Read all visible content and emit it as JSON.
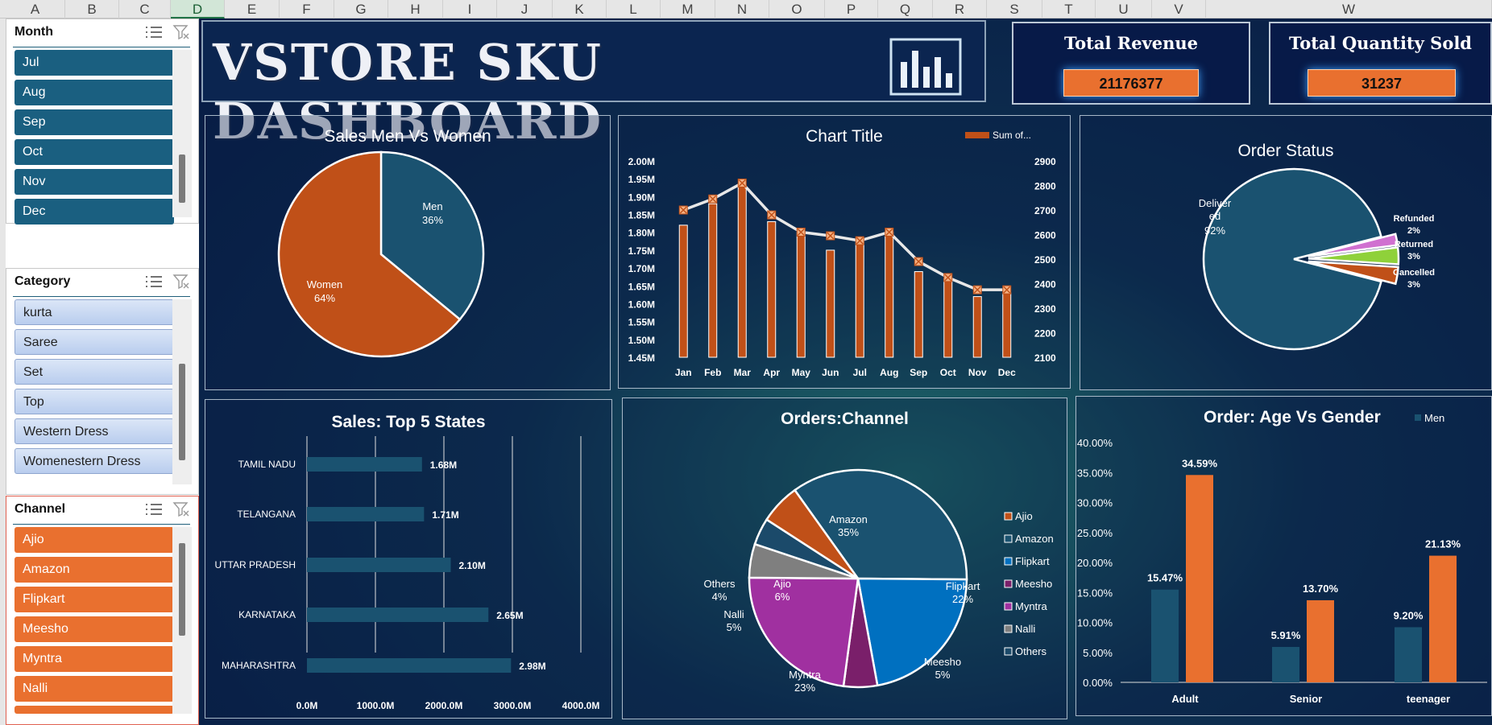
{
  "columns": [
    "A",
    "B",
    "C",
    "D",
    "E",
    "F",
    "G",
    "H",
    "I",
    "J",
    "K",
    "L",
    "M",
    "N",
    "O",
    "P",
    "Q",
    "R",
    "S",
    "T",
    "U",
    "V",
    "W"
  ],
  "selected_column": "D",
  "slicers": {
    "month": {
      "title": "Month",
      "items": [
        "Jul",
        "Aug",
        "Sep",
        "Oct",
        "Nov",
        "Dec"
      ]
    },
    "category": {
      "title": "Category",
      "items": [
        "kurta",
        "Saree",
        "Set",
        "Top",
        "Western Dress",
        "Womenestern Dress"
      ]
    },
    "channel": {
      "title": "Channel",
      "items": [
        "Ajio",
        "Amazon",
        "Flipkart",
        "Meesho",
        "Myntra",
        "Nalli"
      ]
    }
  },
  "dashboard": {
    "title": "VSTORE SKU DASHBOARD"
  },
  "kpis": {
    "revenue": {
      "label": "Total Revenue",
      "value": "21176377"
    },
    "quantity": {
      "label": "Total Quantity Sold",
      "value": "31237"
    }
  },
  "colors": {
    "navy": "#1a5270",
    "orange": "#c05018",
    "bright_orange": "#e9702f",
    "blue": "#0070c0",
    "purple": "#a030a0",
    "dark_purple": "#7a1f6a",
    "gray": "#7f7f7f",
    "green": "#8fd13a",
    "pink": "#d070d0"
  },
  "chart_data": [
    {
      "type": "pie",
      "title": "Sales Men Vs Women",
      "labels": [
        "Men",
        "Women"
      ],
      "values": [
        36,
        64
      ],
      "data_labels": [
        "36%",
        "64%"
      ]
    },
    {
      "type": "bar",
      "title": "Chart Title",
      "legend": "Sum of...",
      "categories": [
        "Jan",
        "Feb",
        "Mar",
        "Apr",
        "May",
        "Jun",
        "Jul",
        "Aug",
        "Sep",
        "Oct",
        "Nov",
        "Dec"
      ],
      "series": [
        {
          "name": "Sum of...",
          "type": "bar",
          "values": [
            1.82,
            1.88,
            1.93,
            1.83,
            1.8,
            1.75,
            1.78,
            1.8,
            1.69,
            1.67,
            1.62,
            1.63
          ],
          "axis": "left"
        },
        {
          "type": "line",
          "values": [
            2700,
            2745,
            2810,
            2680,
            2610,
            2595,
            2575,
            2610,
            2490,
            2425,
            2375,
            2375
          ],
          "axis": "right"
        }
      ],
      "y_left_ticks": [
        "2.00M",
        "1.95M",
        "1.90M",
        "1.85M",
        "1.80M",
        "1.75M",
        "1.70M",
        "1.65M",
        "1.60M",
        "1.55M",
        "1.50M",
        "1.45M"
      ],
      "y_right_ticks": [
        "2900",
        "2800",
        "2700",
        "2600",
        "2500",
        "2400",
        "2300",
        "2200",
        "2100"
      ],
      "ylim_left": [
        1.45,
        2.0
      ],
      "ylim_right": [
        2100,
        2900
      ]
    },
    {
      "type": "pie",
      "title": "Order Status",
      "labels": [
        "Delivered",
        "Refunded",
        "Returned",
        "Cancelled"
      ],
      "values": [
        92,
        2,
        3,
        3
      ],
      "data_labels": [
        [
          "Deliver",
          "ed",
          "92%"
        ],
        [
          "Refunded",
          "2%"
        ],
        [
          "Returned",
          "3%"
        ],
        [
          "Cancelled",
          "3%"
        ]
      ]
    },
    {
      "type": "bar",
      "title": "Sales: Top 5 States",
      "orientation": "horizontal",
      "categories": [
        "TAMIL NADU",
        "TELANGANA",
        "UTTAR PRADESH",
        "KARNATAKA",
        "MAHARASHTRA"
      ],
      "values": [
        1.68,
        1.71,
        2.1,
        2.65,
        2.98
      ],
      "data_labels": [
        "1.68M",
        "1.71M",
        "2.10M",
        "2.65M",
        "2.98M"
      ],
      "x_ticks": [
        "0.0M",
        "1000.0M",
        "2000.0M",
        "3000.0M",
        "4000.0M"
      ],
      "xlim": [
        0,
        4
      ]
    },
    {
      "type": "pie",
      "title": "Orders:Channel",
      "labels": [
        "Ajio",
        "Amazon",
        "Flipkart",
        "Meesho",
        "Myntra",
        "Nalli",
        "Others"
      ],
      "values": [
        6,
        35,
        22,
        5,
        23,
        5,
        4
      ],
      "data_labels": [
        [
          "Ajio",
          "6%"
        ],
        [
          "Amazon",
          "35%"
        ],
        [
          "Flipkart",
          "22%"
        ],
        [
          "Meesho",
          "5%"
        ],
        [
          "Myntra",
          "23%"
        ],
        [
          "Nalli",
          "5%"
        ],
        [
          "Others",
          "4%"
        ]
      ],
      "legend": [
        "Ajio",
        "Amazon",
        "Flipkart",
        "Meesho",
        "Myntra",
        "Nalli",
        "Others"
      ]
    },
    {
      "type": "bar",
      "title": "Order: Age Vs Gender",
      "legend": "Men",
      "categories": [
        "Adult",
        "Senior",
        "teenager"
      ],
      "series": [
        {
          "name": "Men",
          "values": [
            15.47,
            5.91,
            9.2
          ]
        },
        {
          "values": [
            34.59,
            13.7,
            21.13
          ]
        }
      ],
      "data_labels": [
        [
          "15.47%",
          "5.91%",
          "9.20%"
        ],
        [
          "34.59%",
          "13.70%",
          "21.13%"
        ]
      ],
      "y_ticks": [
        "40.00%",
        "35.00%",
        "30.00%",
        "25.00%",
        "20.00%",
        "15.00%",
        "10.00%",
        "5.00%",
        "0.00%"
      ],
      "ylim": [
        0,
        40
      ]
    }
  ]
}
